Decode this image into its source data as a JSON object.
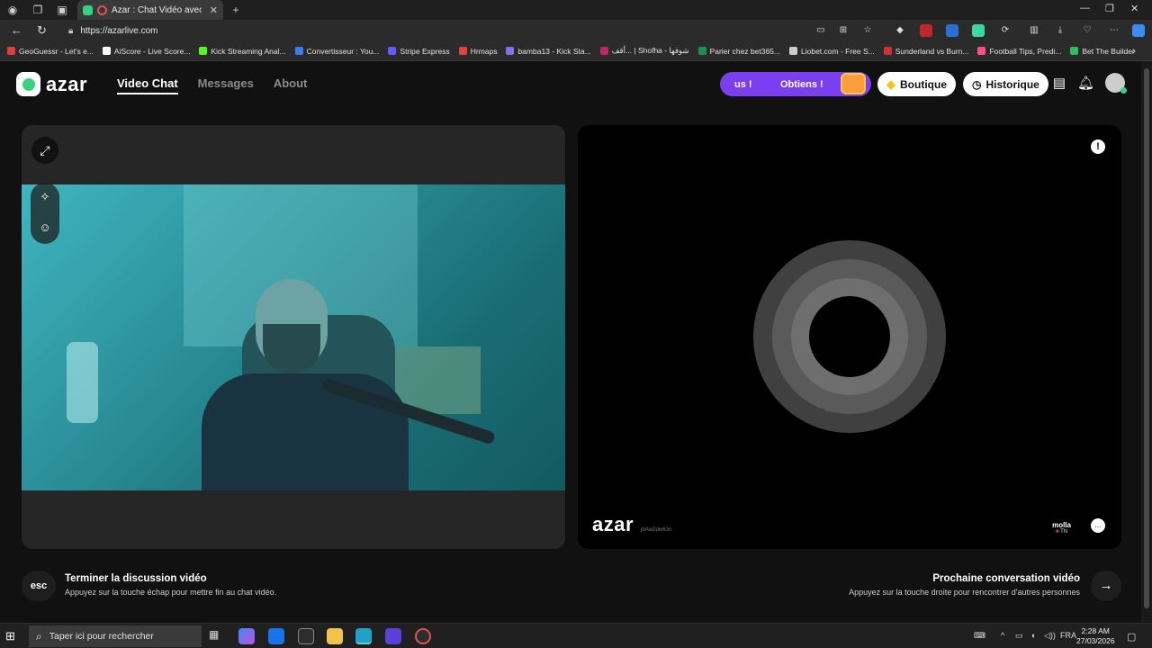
{
  "browser": {
    "tab_title": "Azar : Chat Vidéo avec de n",
    "url": "https://azarlive.com",
    "bookmarks": [
      {
        "label": "GeoGuessr - Let's e...",
        "color": "#e23b3b"
      },
      {
        "label": "AiScore - Live Score...",
        "color": "#ffffff"
      },
      {
        "label": "Kick Streaming Anal...",
        "color": "#53fc18"
      },
      {
        "label": "Convertisseur : You...",
        "color": "#3d7bf0"
      },
      {
        "label": "Stripe Express",
        "color": "#635bff"
      },
      {
        "label": "Hrmaps",
        "color": "#e0433a"
      },
      {
        "label": "bamba13 - Kick Sta...",
        "color": "#8a6cf0"
      },
      {
        "label": "أقف... | Shofha - شوفها",
        "color": "#c4256a"
      },
      {
        "label": "Parier chez bet365...",
        "color": "#1e8f4f"
      },
      {
        "label": "Liobet.com - Free S...",
        "color": "#cccccc"
      },
      {
        "label": "Sunderland vs Burn...",
        "color": "#d32f2f"
      },
      {
        "label": "Football Tips, Predi...",
        "color": "#ff4f8b"
      },
      {
        "label": "Bet The Builder",
        "color": "#2bbf62"
      }
    ]
  },
  "header": {
    "logo": "azar",
    "nav": [
      {
        "label": "Video Chat",
        "active": true
      },
      {
        "label": "Messages",
        "active": false
      },
      {
        "label": "About",
        "active": false
      }
    ],
    "promo_text_1": "us !",
    "promo_text_2": "Obtiens !",
    "shop_label": "Boutique",
    "history_label": "Historique"
  },
  "remote": {
    "watermark": "azar",
    "code": "jbAwZdw63n",
    "username": "molla",
    "country": "TN"
  },
  "footer": {
    "esc_key": "esc",
    "esc_title": "Terminer la discussion vidéo",
    "esc_sub": "Appuyez sur la touche échap pour mettre fin au chat vidéo.",
    "next_title": "Prochaine conversation vidéo",
    "next_sub": "Appuyez sur la touche droite pour rencontrer d'autres personnes"
  },
  "taskbar": {
    "search_placeholder": "Taper ici pour rechercher",
    "lang": "FRA",
    "time": "2:28 AM",
    "date": "27/03/2026"
  },
  "colors": {
    "accent_green": "#35d27f",
    "promo_purple": "#7b3ff0"
  }
}
